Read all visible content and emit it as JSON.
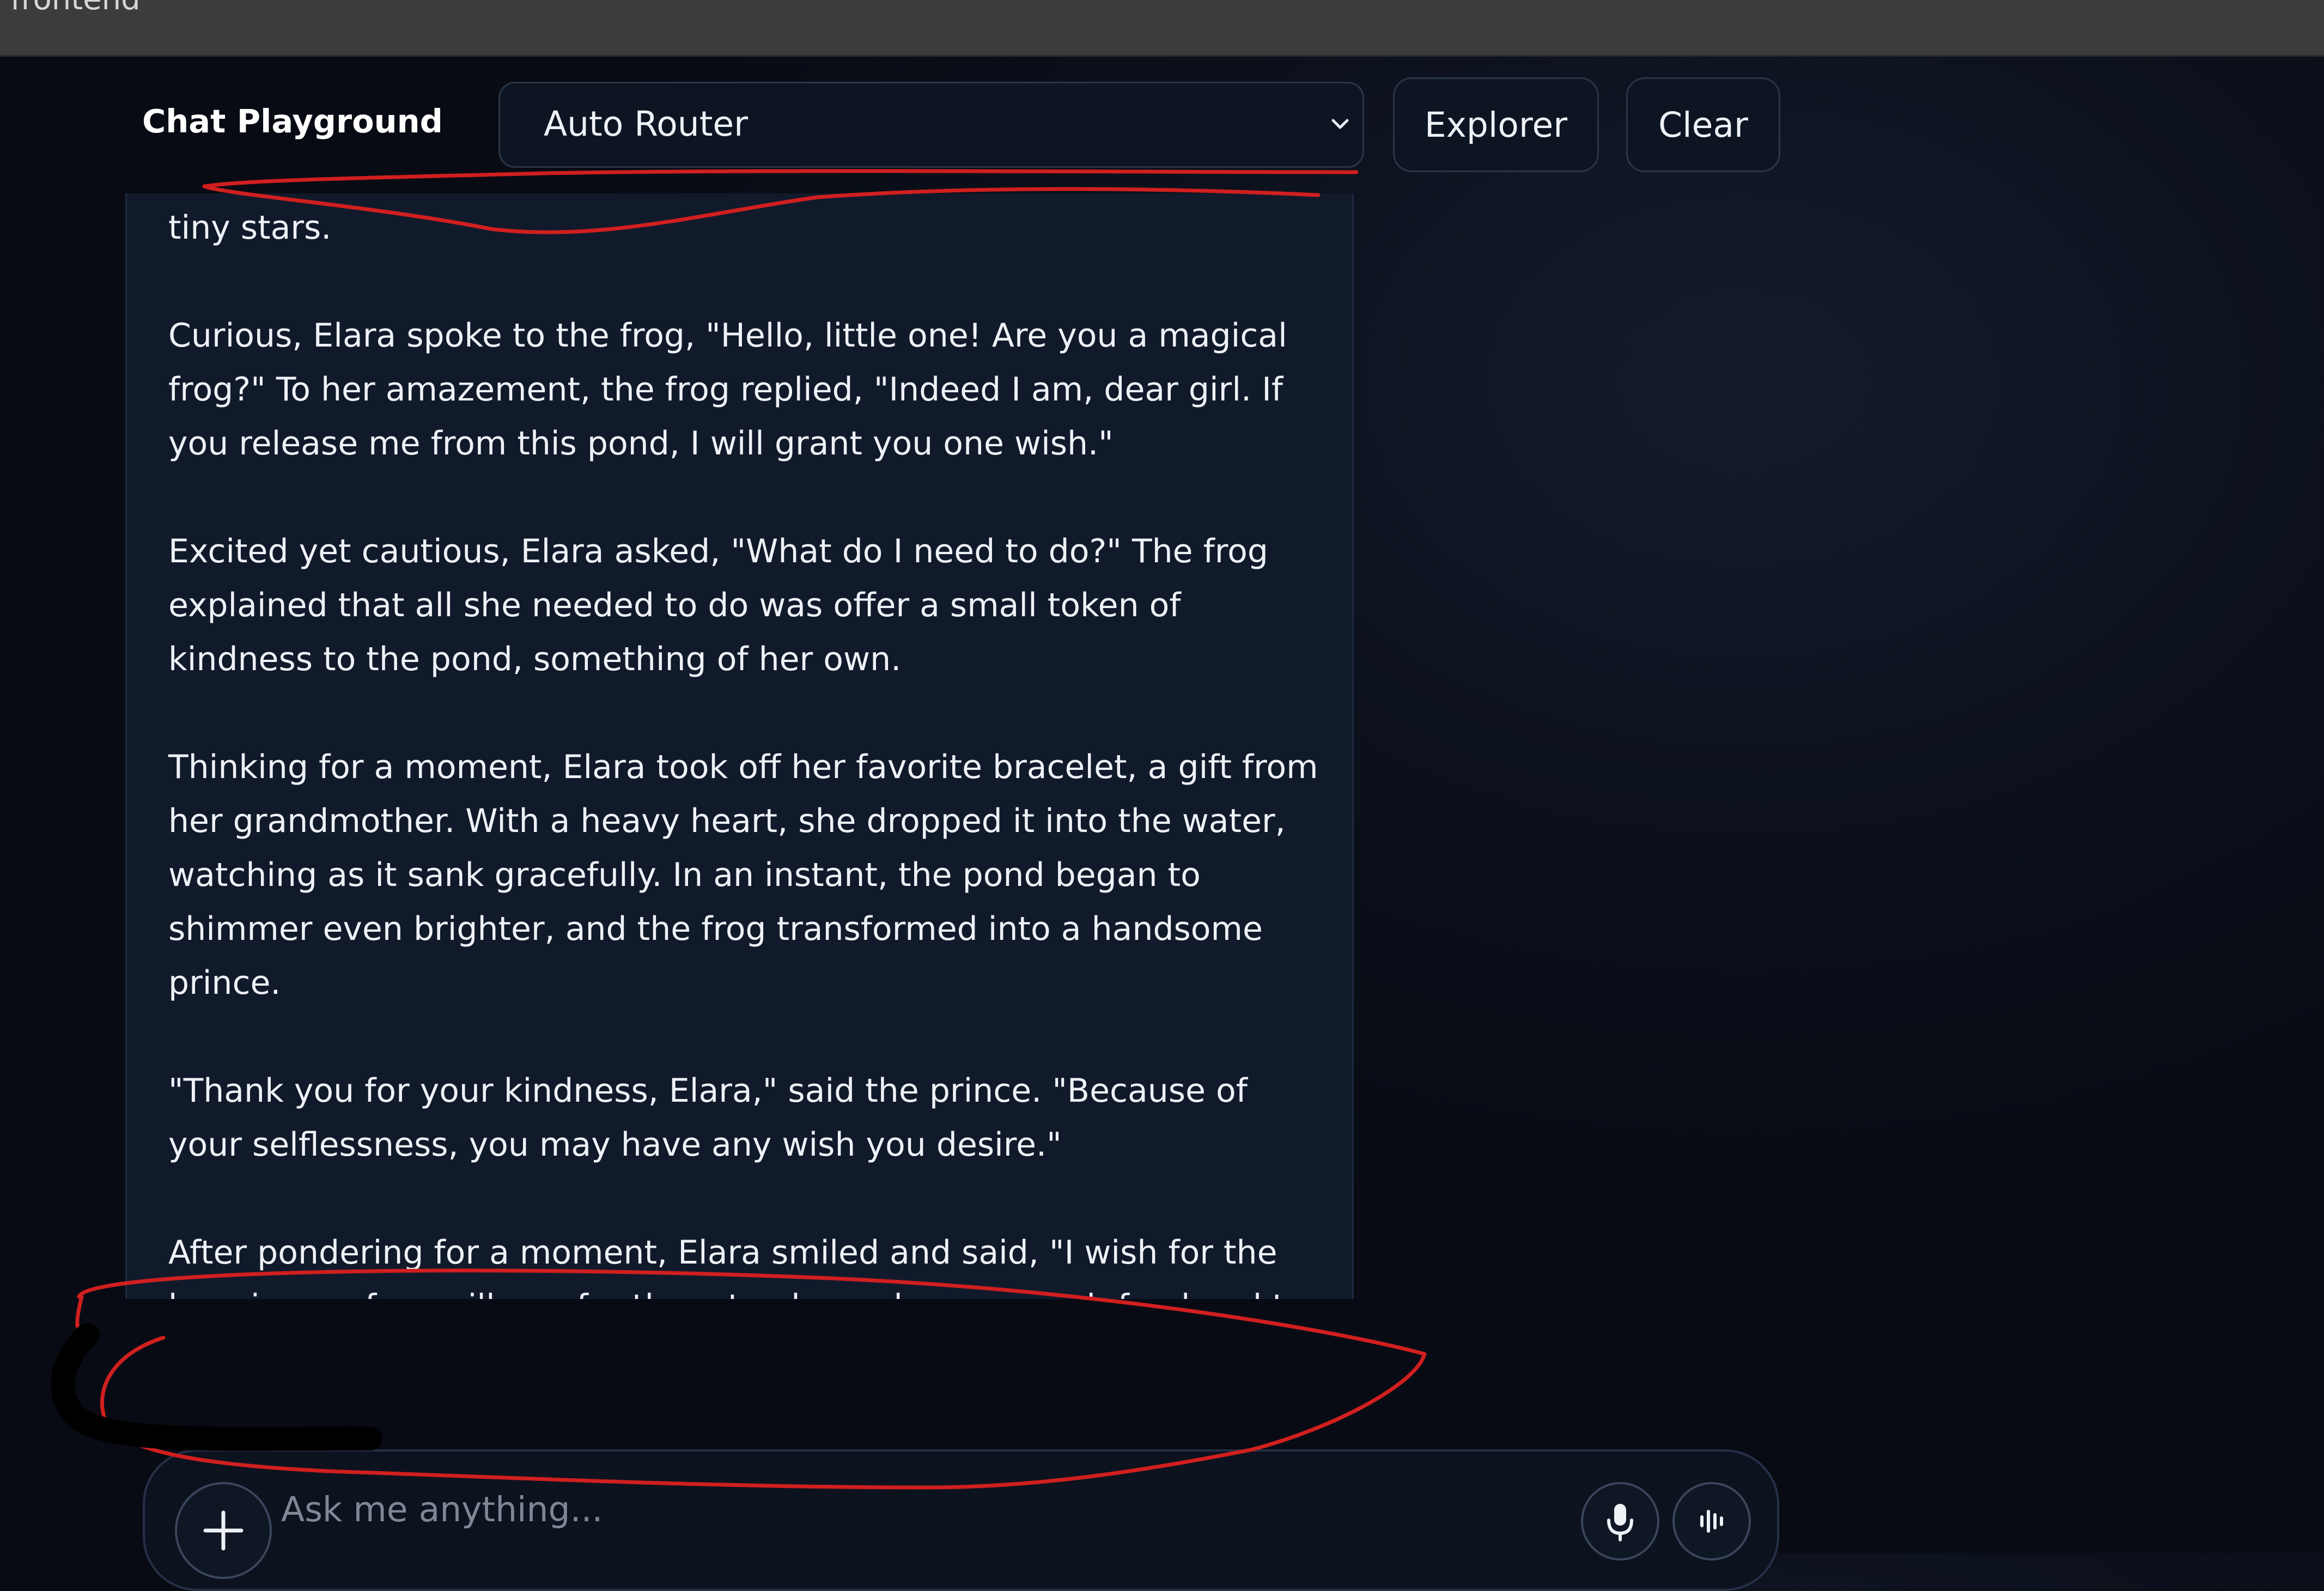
{
  "window": {
    "title": "frontend"
  },
  "header": {
    "title": "Chat Playground",
    "model_select": {
      "selected": "Auto Router"
    },
    "explorer_label": "Explorer",
    "clear_label": "Clear"
  },
  "message": {
    "paragraphs": [
      "skin glimmered in shades of gold and silver, and its eyes sparkled like tiny stars.",
      "Curious, Elara spoke to the frog, \"Hello, little one! Are you a magical frog?\" To her amazement, the frog replied, \"Indeed I am, dear girl. If you release me from this pond, I will grant you one wish.\"",
      "Excited yet cautious, Elara asked, \"What do I need to do?\" The frog explained that all she needed to do was offer a small token of kindness to the pond, something of her own.",
      "Thinking for a moment, Elara took off her favorite bracelet, a gift from her grandmother. With a heavy heart, she dropped it into the water, watching as it sank gracefully. In an instant, the pond began to shimmer even brighter, and the frog transformed into a handsome prince.",
      "\"Thank you for your kindness, Elara,\" said the prince. \"Because of your selflessness, you may have any wish you desire.\"",
      "After pondering for a moment, Elara smiled and said, \"I wish for the happiness of my village, for them to always have enough food and to live"
    ]
  },
  "composer": {
    "placeholder": "Ask me anything...",
    "icons": {
      "attach": "plus-icon",
      "mic": "microphone-icon",
      "voice": "voice-waveform-icon"
    }
  },
  "annotations": {
    "ink_color": "#d11f1f"
  }
}
